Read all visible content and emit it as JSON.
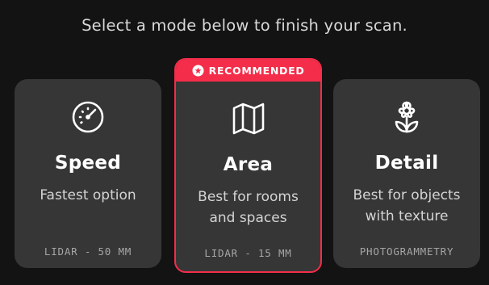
{
  "prompt": "Select a mode below to finish your scan.",
  "accent_color": "#f42d4a",
  "modes": [
    {
      "title": "Speed",
      "description_line1": "Fastest option",
      "description_line2": "",
      "spec": "LIDAR - 50 MM",
      "icon": "speedometer-icon",
      "recommended": false
    },
    {
      "title": "Area",
      "description_line1": "Best for rooms",
      "description_line2": "and spaces",
      "spec": "LIDAR - 15 MM",
      "icon": "map-icon",
      "recommended": true
    },
    {
      "title": "Detail",
      "description_line1": "Best for objects",
      "description_line2": "with texture",
      "spec": "PHOTOGRAMMETRY",
      "icon": "flower-icon",
      "recommended": false
    }
  ],
  "recommended_label": "RECOMMENDED"
}
